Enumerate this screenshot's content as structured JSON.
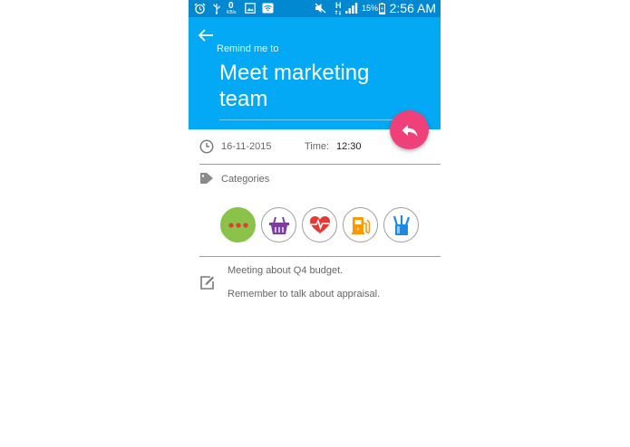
{
  "status_bar": {
    "data_speed_value": "0",
    "data_speed_unit": "KB/s",
    "network_type": "H",
    "battery_percent": "15%",
    "time": "2:56 AM",
    "icons": [
      "alarm-icon",
      "usb-icon",
      "data-speed-icon",
      "screenshot-icon",
      "wifi-icon",
      "mute-icon",
      "network-h-icon",
      "signal-icon",
      "battery-icon"
    ]
  },
  "header": {
    "back_icon": "back-arrow-icon",
    "remind_label": "Remind me to",
    "title": "Meet marketing team"
  },
  "fab": {
    "icon": "reply-icon"
  },
  "schedule": {
    "clock_icon": "clock-icon",
    "date": "16-11-2015",
    "time_label": "Time:",
    "time_value": "12:30"
  },
  "categories": {
    "tag_icon": "tag-icon",
    "label": "Categories",
    "items": [
      {
        "name": "more",
        "icon": "more-dots-icon",
        "selected": true
      },
      {
        "name": "shopping",
        "icon": "basket-icon",
        "selected": false
      },
      {
        "name": "health",
        "icon": "heart-pulse-icon",
        "selected": false
      },
      {
        "name": "fuel",
        "icon": "fuel-pump-icon",
        "selected": false
      },
      {
        "name": "stationery",
        "icon": "pencil-cup-icon",
        "selected": false
      }
    ]
  },
  "notes": {
    "edit_icon": "edit-note-icon",
    "lines": [
      "Meeting about Q4 budget.",
      "Remember to talk about appraisal."
    ]
  },
  "colors": {
    "status_bar": "#0288d1",
    "header": "#03a9f4",
    "fab": "#f0407a",
    "selected_category": "#8bc34a",
    "basket": "#7b3fa0",
    "heart": "#e53935",
    "fuel": "#ff9800",
    "pencils": "#1e88e5"
  }
}
